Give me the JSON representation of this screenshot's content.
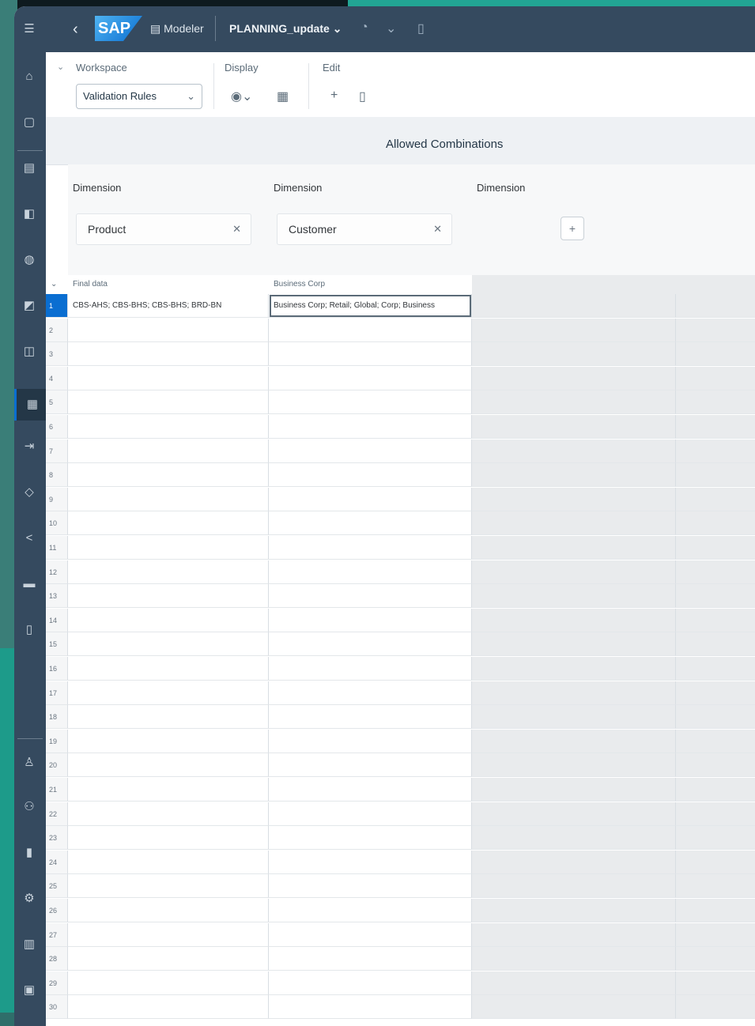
{
  "shell": {
    "logo": "SAP",
    "model_label": "Modeler",
    "plan_title": "PLANNING_update",
    "plan_chevron": "⌄"
  },
  "toolbar": {
    "workspace_label": "Workspace",
    "workspace_value": "Validation Rules",
    "display_label": "Display",
    "edit_label": "Edit"
  },
  "sheet": {
    "title": "Allowed Combinations",
    "columns": [
      {
        "header_label": "Dimension",
        "token": "Product",
        "sub_label": "Final data",
        "row1": "CBS-AHS; CBS-BHS; CBS-BHS; BRD-BN"
      },
      {
        "header_label": "Dimension",
        "token": "Customer",
        "sub_label": "Business Corp",
        "row1": "Business Corp; Retail; Global; Corp; Business"
      },
      {
        "header_label": "Dimension",
        "token": "",
        "sub_label": "",
        "row1": ""
      }
    ],
    "row_numbers": [
      "1",
      "2",
      "3",
      "4",
      "5",
      "6",
      "7",
      "8",
      "9",
      "10",
      "11",
      "12",
      "13",
      "14",
      "15",
      "16",
      "17",
      "18",
      "19",
      "20",
      "21",
      "22",
      "23",
      "24",
      "25",
      "26",
      "27",
      "28",
      "29",
      "30"
    ]
  }
}
